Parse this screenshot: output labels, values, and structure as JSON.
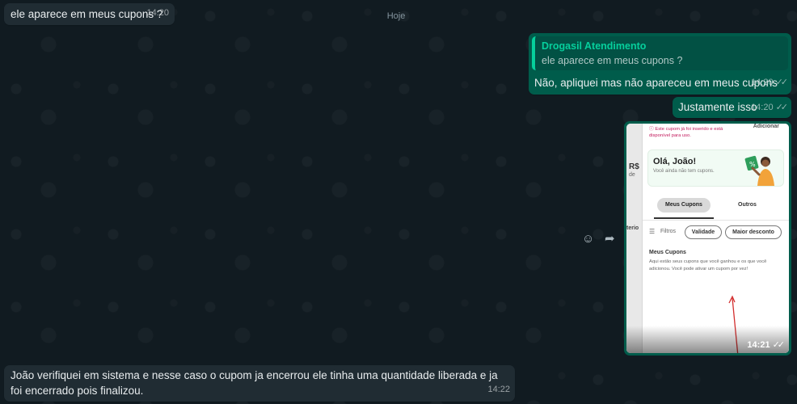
{
  "chat": {
    "date_divider": "Hoje",
    "msg1": {
      "text": "ele aparece em meus cupons ?",
      "time": "14:20"
    },
    "msg2": {
      "quote_author": "Drogasil Atendimento",
      "quote_text": "ele aparece em meus cupons ?",
      "text": "Não, apliquei mas não apareceu em meus cupons",
      "time": "14:20"
    },
    "msg3": {
      "text": "Justamente isso",
      "time": "14:20"
    },
    "msg4_image": {
      "time": "14:21",
      "screenshot": {
        "warning": "Este cupom já foi inserido e está disponível para uso.",
        "add_label": "Adicionar",
        "left_price": "R$",
        "left_sub": "de",
        "left_section": "terio",
        "greeting": "Olá, João!",
        "no_coupons": "Você ainda não tem cupons.",
        "tab_active": "Meus Cupons",
        "tab_other": "Outros",
        "filters_label": "Filtros",
        "chip_validity": "Validade",
        "chip_discount": "Maior desconto",
        "section_title": "Meus Cupons",
        "section_text": "Aqui estão seus cupons que você ganhou e os que você adicionou. Você pode ativar um cupom por vez!"
      }
    },
    "msg5": {
      "text": "João verifiquei em sistema e nesse caso o cupom ja encerrou ele tinha uma quantidade liberada e ja foi encerrado pois finalizou.",
      "time": "14:22"
    }
  },
  "icons": {
    "emoji": "☺",
    "forward": "➦",
    "double_check": "✓✓"
  },
  "colors": {
    "incoming_bubble": "#202c33",
    "outgoing_bubble": "#005c4b",
    "quote_accent": "#06cf9c"
  }
}
